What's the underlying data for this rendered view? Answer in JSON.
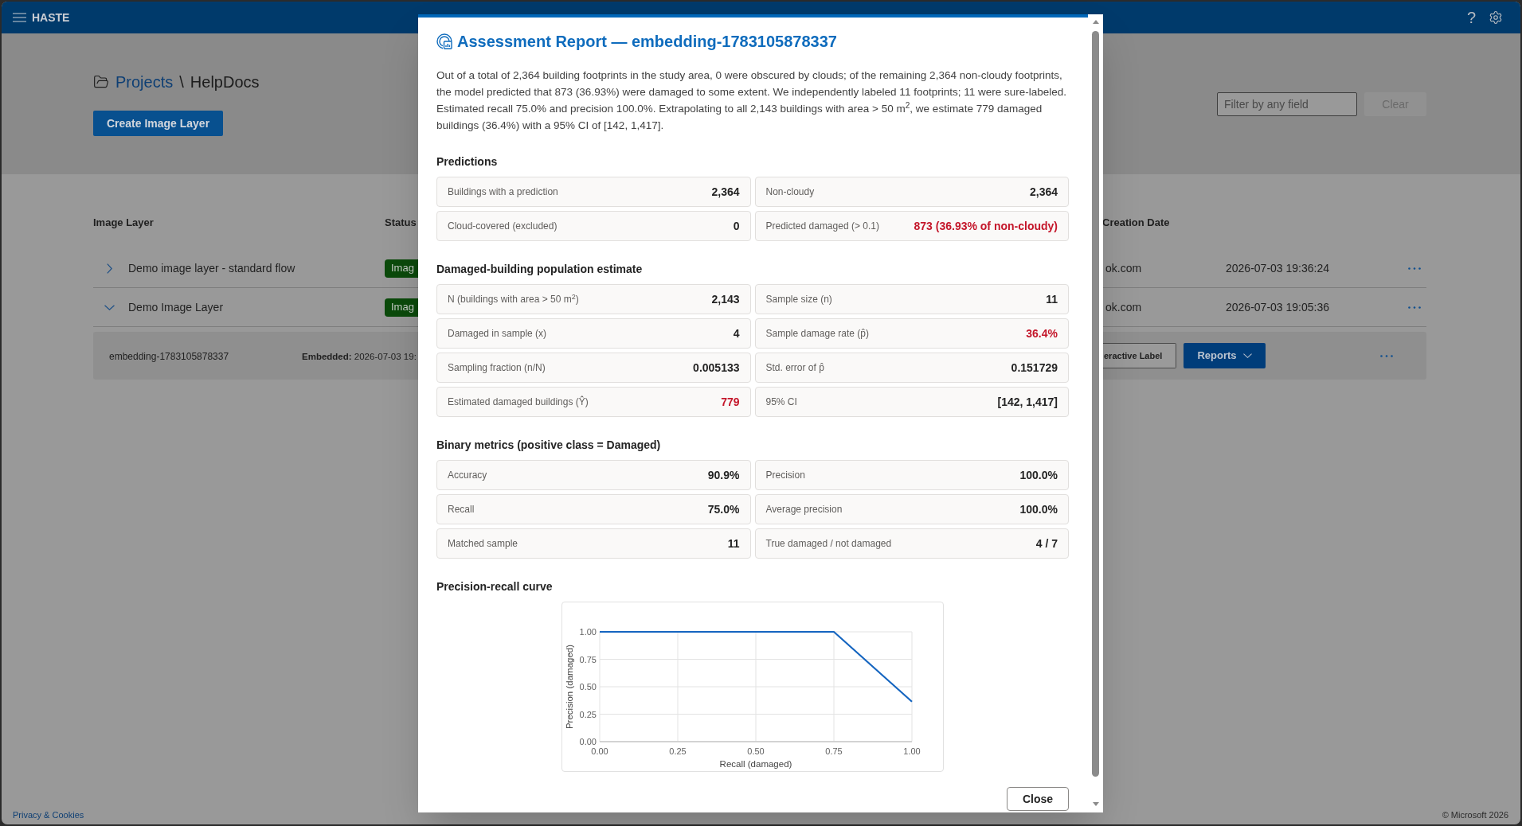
{
  "header": {
    "app_name": "HASTE",
    "help_button": "?"
  },
  "page": {
    "breadcrumb": {
      "parent": "Projects",
      "separator": "\\",
      "current": "HelpDocs"
    },
    "create_button": "Create Image Layer",
    "filter": {
      "placeholder": "Filter by any field"
    },
    "clear_button": {
      "label": "Clear",
      "disabled": true
    }
  },
  "table": {
    "columns": {
      "image_layer": "Image Layer",
      "status": "Status",
      "creation_date": "Creation Date"
    },
    "rows": [
      {
        "expanded": false,
        "name": "Demo image layer - standard flow",
        "status": "Imag",
        "column_3": "ok.com",
        "creation_date": "2026-07-03 19:36:24"
      },
      {
        "expanded": true,
        "name": "Demo Image Layer",
        "status": "Imag",
        "column_3": "ok.com",
        "creation_date": "2026-07-03 19:05:36",
        "embeddings": [
          {
            "name": "embedding-1783105878337",
            "embedded": "**Embedded:** 2026-07-03 19:",
            "label_button": "eractive Label",
            "reports_button": "Reports"
          }
        ]
      }
    ]
  },
  "modal": {
    "title": "Assessment Report — embedding-1783105878337",
    "summary": "Out of a total of 2,364 building footprints in the study area, 0 were obscured by clouds; of the remaining 2,364 non-cloudy footprints, the model predicted that 873 (36.93%) were damaged to some extent. We independently labeled 11 footprints; 11 were sure-labeled. Estimated recall 75.0% and precision 100.0%. Extrapolating to all 2,143 buildings with area > 50 m$^{2}$, we estimate 779 damaged buildings (36.4%) with a 95% CI of [142, 1,417].",
    "sections": [
      {
        "kind": "cards",
        "heading": "Predictions",
        "items": [
          {
            "label": "Buildings with a prediction",
            "value": "2,364",
            "highlighted": false
          },
          {
            "label": "Non-cloudy",
            "value": "2,364",
            "highlighted": false
          },
          {
            "label": "Cloud-covered (excluded)",
            "value": "0",
            "highlighted": false
          },
          {
            "label": "Predicted damaged (> 0.1)",
            "value": "873 (36.93% of non-cloudy)",
            "highlighted": true
          }
        ]
      },
      {
        "kind": "cards",
        "heading": "Damaged-building population estimate",
        "items": [
          {
            "label": "N (buildings with area > 50 m$^{2}$)",
            "value": "2,143",
            "highlighted": false
          },
          {
            "label": "Sample size (n)",
            "value": "11",
            "highlighted": false
          },
          {
            "label": "Damaged in sample (x)",
            "value": "4",
            "highlighted": false
          },
          {
            "label": "Sample damage rate (p̂)",
            "value": "36.4%",
            "highlighted": true
          },
          {
            "label": "Sampling fraction (n/N)",
            "value": "0.005133",
            "highlighted": false
          },
          {
            "label": "Std. error of p̂",
            "value": "0.151729",
            "highlighted": false
          },
          {
            "label": "Estimated damaged buildings (Ŷ)",
            "value": "779",
            "highlighted": true
          },
          {
            "label": "95% CI",
            "value": "[142, 1,417]",
            "highlighted": false
          }
        ]
      },
      {
        "kind": "cards",
        "heading": "Binary metrics (positive class = Damaged)",
        "items": [
          {
            "label": "Accuracy",
            "value": "90.9%",
            "highlighted": false
          },
          {
            "label": "Precision",
            "value": "100.0%",
            "highlighted": false
          },
          {
            "label": "Recall",
            "value": "75.0%",
            "highlighted": false
          },
          {
            "label": "Average precision",
            "value": "100.0%",
            "highlighted": false
          },
          {
            "label": "Matched sample",
            "value": "11",
            "highlighted": false
          },
          {
            "label": "True damaged / not damaged",
            "value": "4 / 7",
            "highlighted": false
          }
        ]
      },
      {
        "kind": "chart",
        "heading": "Precision-recall curve",
        "chart_data": {
          "type": "line",
          "xlabel": "Recall (damaged)",
          "ylabel": "Precision (damaged)",
          "x": [
            0,
            0.75,
            1
          ],
          "series": [
            {
              "color": "#1565c0",
              "values": [
                1,
                1,
                0.364
              ]
            }
          ],
          "xlim": [
            0,
            1
          ],
          "ylim": [
            0,
            1
          ],
          "xticks": [
            {
              "value": 0,
              "label": "0.00"
            },
            {
              "value": 0.25,
              "label": "0.25"
            },
            {
              "value": 0.5,
              "label": "0.50"
            },
            {
              "value": 0.75,
              "label": "0.75"
            },
            {
              "value": 1,
              "label": "1.00"
            }
          ],
          "yticks": [
            {
              "value": 0,
              "label": "0.00"
            },
            {
              "value": 0.25,
              "label": "0.25"
            },
            {
              "value": 0.5,
              "label": "0.50"
            },
            {
              "value": 0.75,
              "label": "0.75"
            },
            {
              "value": 1,
              "label": "1.00"
            }
          ],
          "grid": true
        }
      }
    ],
    "close_button": "Close"
  },
  "footer": {
    "privacy_link": "Privacy & Cookies",
    "copyright": "© Microsoft 2026"
  }
}
